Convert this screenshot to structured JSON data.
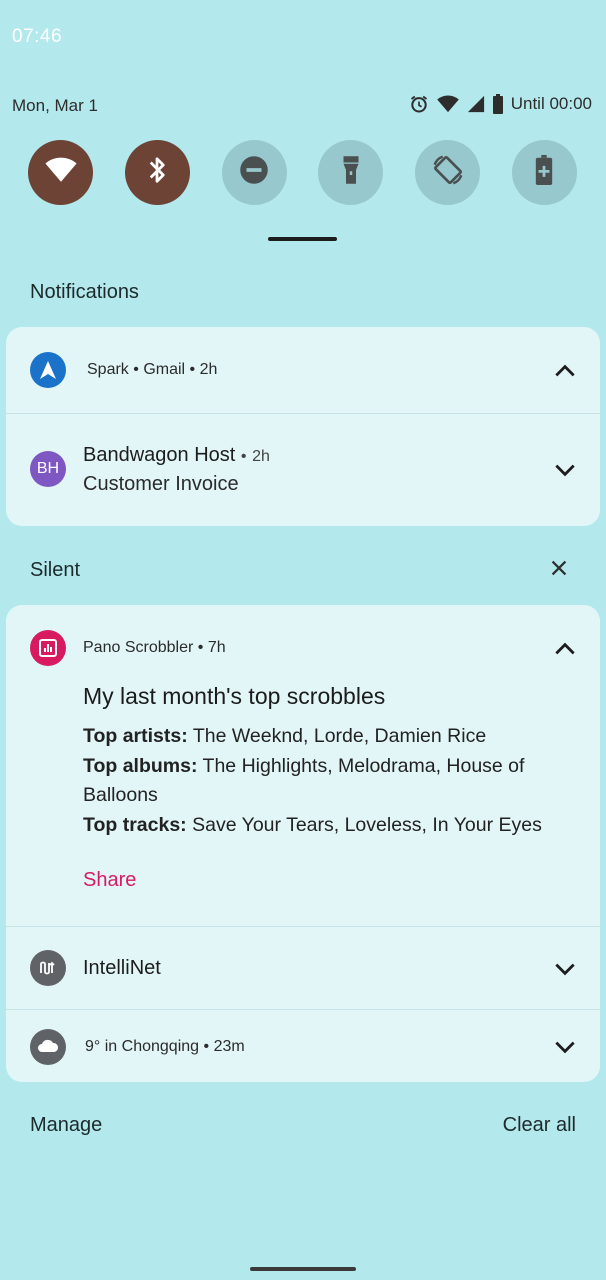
{
  "status_bar": {
    "time": "07:46",
    "date": "Mon, Mar 1",
    "alarm": "Until 00:00"
  },
  "quick_tiles": [
    {
      "name": "wifi",
      "state": "on"
    },
    {
      "name": "bluetooth",
      "state": "on"
    },
    {
      "name": "do-not-disturb",
      "state": "off"
    },
    {
      "name": "flashlight",
      "state": "off"
    },
    {
      "name": "auto-rotate",
      "state": "off"
    },
    {
      "name": "battery-saver",
      "state": "off"
    }
  ],
  "sections": {
    "notifications_label": "Notifications",
    "silent_label": "Silent"
  },
  "notifications": {
    "spark": {
      "app": "Spark",
      "separator1": "•",
      "account": "Gmail",
      "separator2": "•",
      "time": "2h"
    },
    "bandwagon": {
      "avatar": "BH",
      "sender": "Bandwagon Host",
      "separator": "•",
      "time": "2h",
      "subject": "Customer Invoice"
    }
  },
  "silent": {
    "pano": {
      "app": "Pano Scrobbler",
      "separator": "•",
      "time": "7h",
      "title": "My last month's top scrobbles",
      "artists_label": "Top artists:",
      "artists": "The Weeknd, Lorde, Damien Rice",
      "albums_label": "Top albums:",
      "albums": "The Highlights, Melodrama, House of Balloons",
      "tracks_label": "Top tracks:",
      "tracks": "Save Your Tears, Loveless, In Your Eyes",
      "action": "Share"
    },
    "intellinet": {
      "app": "IntelliNet"
    },
    "weather": {
      "text": "9° in Chongqing",
      "separator": "•",
      "time": "23m"
    }
  },
  "footer": {
    "manage": "Manage",
    "clear_all": "Clear all"
  },
  "colors": {
    "background": "#b3e8ed",
    "tile_on": "#6d4336",
    "tile_off": "#96c8cd",
    "card": "#e2f6f8",
    "accent_share": "#d81b60",
    "spark_icon": "#1a73c8",
    "bandwagon_avatar": "#7e57c2",
    "pano_icon": "#d81b60",
    "grey_icon": "#5f6368"
  }
}
